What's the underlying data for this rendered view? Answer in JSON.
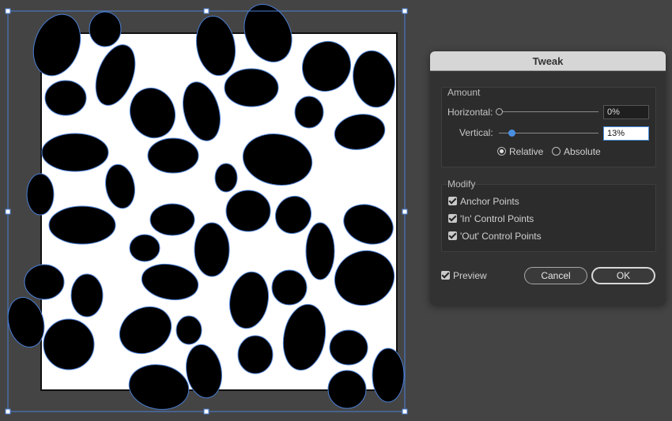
{
  "dialog": {
    "title": "Tweak",
    "amount": {
      "label": "Amount",
      "horizontal_label": "Horizontal:",
      "horizontal_value": "0%",
      "horizontal_level": 0,
      "vertical_label": "Vertical:",
      "vertical_value": "13%",
      "vertical_level": 0.13,
      "relative_label": "Relative",
      "absolute_label": "Absolute",
      "selected_mode": "relative"
    },
    "modify": {
      "label": "Modify",
      "anchor_points_label": "Anchor Points",
      "in_points_label": "'In' Control Points",
      "out_points_label": "'Out' Control Points",
      "anchor_points_checked": true,
      "in_points_checked": true,
      "out_points_checked": true
    },
    "preview_label": "Preview",
    "preview_checked": true,
    "cancel_label": "Cancel",
    "ok_label": "OK"
  },
  "colors": {
    "pasteboard": "#444444",
    "artboard": "#ffffff",
    "spots": "#000000",
    "selection": "#4a7fd6",
    "slider_active": "#4a90e2"
  }
}
